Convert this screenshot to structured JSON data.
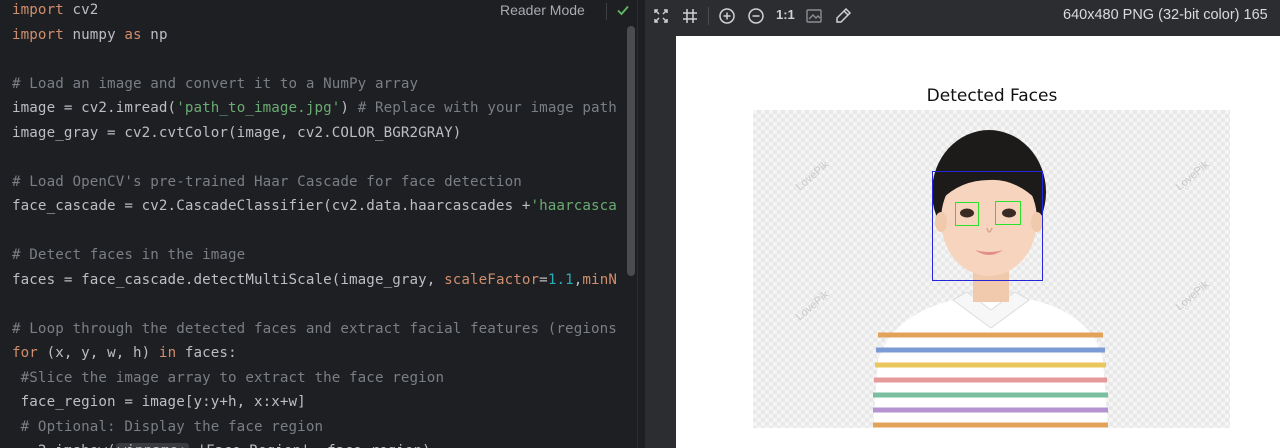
{
  "editor": {
    "reader_mode_label": "Reader Mode",
    "lines": [
      {
        "tokens": [
          {
            "t": "import",
            "c": "kw"
          },
          {
            "t": " cv2",
            "c": ""
          }
        ]
      },
      {
        "tokens": [
          {
            "t": "import",
            "c": "kw"
          },
          {
            "t": " numpy ",
            "c": ""
          },
          {
            "t": "as",
            "c": "kw"
          },
          {
            "t": " np",
            "c": ""
          }
        ]
      },
      {
        "tokens": []
      },
      {
        "tokens": [
          {
            "t": "# Load an image and convert it to a NumPy array",
            "c": "cm"
          }
        ]
      },
      {
        "tokens": [
          {
            "t": "image = cv2.imread(",
            "c": ""
          },
          {
            "t": "'path_to_image.jpg'",
            "c": "st"
          },
          {
            "t": ") ",
            "c": ""
          },
          {
            "t": "# Replace with your image path",
            "c": "cm"
          }
        ]
      },
      {
        "tokens": [
          {
            "t": "image_gray = cv2.cvtColor(image, cv2.COLOR_BGR2GRAY)",
            "c": ""
          }
        ]
      },
      {
        "tokens": []
      },
      {
        "tokens": [
          {
            "t": "# Load OpenCV's pre-trained Haar Cascade for face detection",
            "c": "cm"
          }
        ]
      },
      {
        "tokens": [
          {
            "t": "face_cascade = cv2.CascadeClassifier(cv2.data.haarcascades +",
            "c": ""
          },
          {
            "t": "'haarcasca",
            "c": "st"
          }
        ]
      },
      {
        "tokens": []
      },
      {
        "tokens": [
          {
            "t": "# Detect faces in the image",
            "c": "cm"
          }
        ]
      },
      {
        "tokens": [
          {
            "t": "faces = face_cascade.detectMultiScale(image_gray, ",
            "c": ""
          },
          {
            "t": "scaleFactor",
            "c": "pm"
          },
          {
            "t": "=",
            "c": ""
          },
          {
            "t": "1.1",
            "c": "nm"
          },
          {
            "t": ",",
            "c": ""
          },
          {
            "t": "minN",
            "c": "pm"
          }
        ]
      },
      {
        "tokens": []
      },
      {
        "tokens": [
          {
            "t": "# Loop through the detected faces and extract facial features (regions",
            "c": "cm"
          }
        ]
      },
      {
        "tokens": [
          {
            "t": "for",
            "c": "kw"
          },
          {
            "t": " (x, y, w, h) ",
            "c": ""
          },
          {
            "t": "in",
            "c": "kw"
          },
          {
            "t": " faces:",
            "c": ""
          }
        ]
      },
      {
        "tokens": [
          {
            "t": " #Slice the image array to extract the face region",
            "c": "cm"
          }
        ]
      },
      {
        "tokens": [
          {
            "t": " face_region = image[y:y+h, x:x+w]",
            "c": ""
          }
        ]
      },
      {
        "tokens": [
          {
            "t": " # Optional: Display the face region",
            "c": "cm"
          }
        ]
      },
      {
        "tokens": [
          {
            "t": "   2.imshow(",
            "c": ""
          },
          {
            "t": "winname:",
            "c": "pill"
          },
          {
            "t": " 'Face Region', face_region)",
            "c": ""
          }
        ]
      }
    ]
  },
  "viewer": {
    "toolbar_icons": [
      "fit-to-window-icon",
      "actual-grid-icon",
      "zoom-in-icon",
      "zoom-out-icon",
      "background-toggle-icon",
      "color-picker-icon"
    ],
    "zoom_label": "1:1",
    "image_info": "640x480 PNG (32-bit color) 165",
    "plot_title": "Detected Faces",
    "watermark_text": "LovePik",
    "face_box_color": "#2626d9",
    "eye_box_color": "#29e329"
  }
}
